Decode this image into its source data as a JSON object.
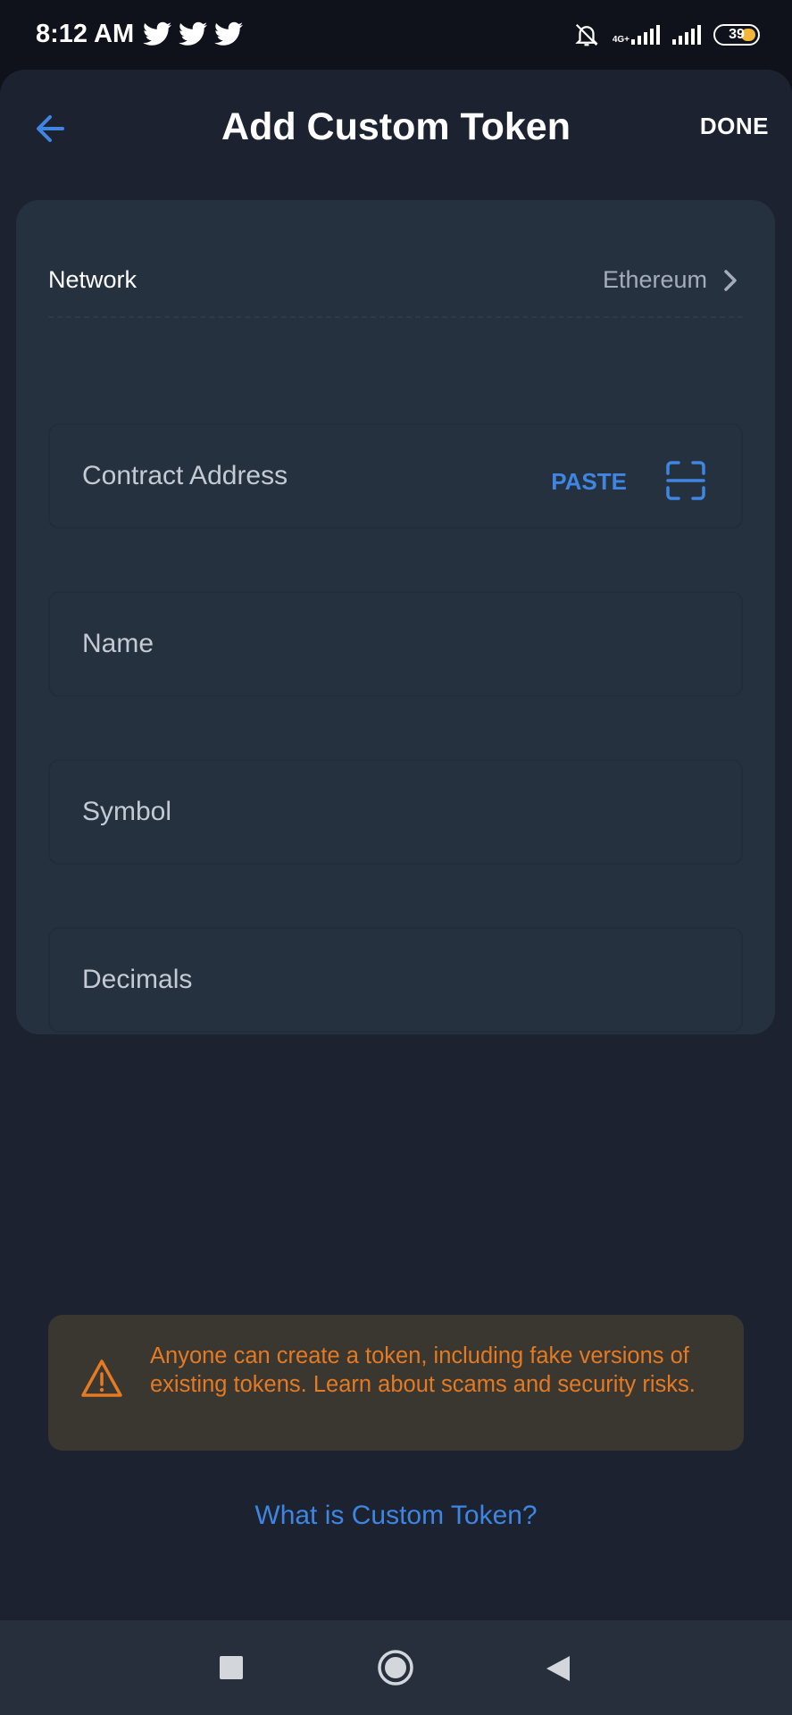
{
  "status_bar": {
    "time": "8:12 AM",
    "network_type": "4G+",
    "battery_level": "39",
    "icons": [
      "twitter-icon",
      "twitter-icon",
      "twitter-icon",
      "bell-off-icon",
      "signal-icon",
      "signal-icon",
      "battery-icon"
    ]
  },
  "header": {
    "title": "Add Custom Token",
    "done_label": "DONE",
    "back_icon": "arrow-left-icon"
  },
  "form": {
    "network_label": "Network",
    "network_value": "Ethereum",
    "contract_placeholder": "Contract Address",
    "paste_label": "PASTE",
    "scan_icon": "scan-icon",
    "name_placeholder": "Name",
    "symbol_placeholder": "Symbol",
    "decimals_placeholder": "Decimals"
  },
  "warning": {
    "text": "Anyone can create a token, including fake versions of existing tokens. Learn about scams and security risks.",
    "icon": "warning-icon"
  },
  "help_link": "What is Custom Token?",
  "colors": {
    "accent": "#3e86e2",
    "warning": "#e37a24",
    "card": "#263140",
    "background": "#1c2230"
  },
  "nav_bar": {
    "icons": [
      "recents-icon",
      "home-icon",
      "back-icon"
    ]
  }
}
